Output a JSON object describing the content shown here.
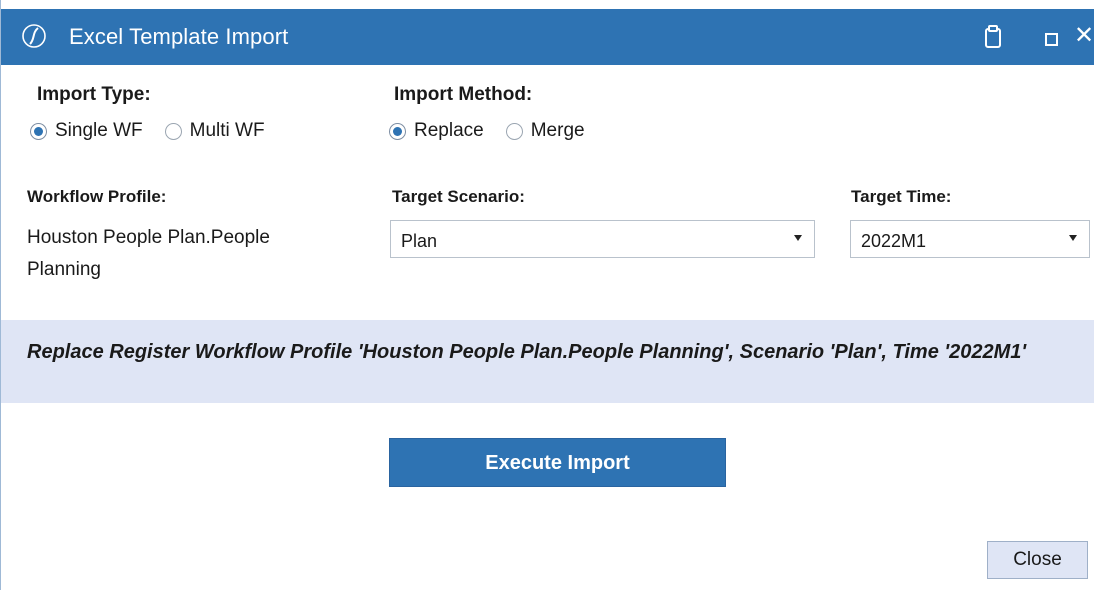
{
  "window": {
    "title": "Excel Template Import",
    "icons": [
      "app-logo-icon",
      "clipboard-icon",
      "maximize-icon",
      "close-icon"
    ],
    "close_glyph": "✕"
  },
  "import_type": {
    "label": "Import Type:",
    "options": [
      {
        "label": "Single WF",
        "checked": true
      },
      {
        "label": "Multi WF",
        "checked": false
      }
    ]
  },
  "import_method": {
    "label": "Import Method:",
    "options": [
      {
        "label": "Replace",
        "checked": true
      },
      {
        "label": "Merge",
        "checked": false
      }
    ]
  },
  "workflow_profile": {
    "label": "Workflow Profile:",
    "value": "Houston People Plan.People Planning"
  },
  "target_scenario": {
    "label": "Target Scenario:",
    "value": "Plan"
  },
  "target_time": {
    "label": "Target Time:",
    "value": "2022M1"
  },
  "banner": {
    "message": "Replace Register Workflow Profile 'Houston People Plan.People Planning', Scenario 'Plan', Time '2022M1'"
  },
  "buttons": {
    "execute": "Execute Import",
    "close": "Close"
  },
  "colors": {
    "accent": "#2e73b3",
    "banner_bg": "#dfe5f5"
  }
}
